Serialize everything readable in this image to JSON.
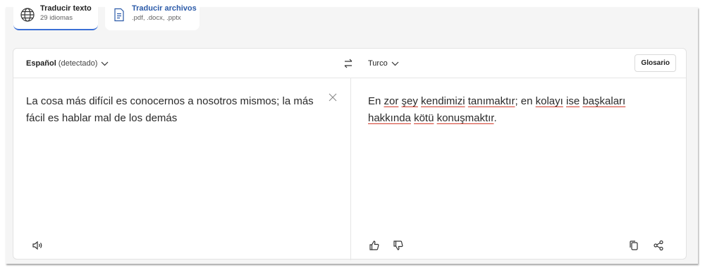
{
  "tabs": [
    {
      "title": "Traducir texto",
      "subtitle": "29 idiomas",
      "icon": "globe-icon",
      "active": true
    },
    {
      "title": "Traducir archivos",
      "subtitle": ".pdf, .docx, .pptx",
      "icon": "document-icon",
      "active": false
    }
  ],
  "source": {
    "language": "Español",
    "detected": "(detectado)",
    "text": "La cosa más difícil es conocernos a nosotros mismos; la más fácil es hablar mal de los demás"
  },
  "target": {
    "language": "Turco",
    "segments": [
      {
        "text": "En ",
        "flag": false
      },
      {
        "text": "zor",
        "flag": true
      },
      {
        "text": " ",
        "flag": false
      },
      {
        "text": "şey",
        "flag": true
      },
      {
        "text": " ",
        "flag": false
      },
      {
        "text": "kendimizi",
        "flag": true
      },
      {
        "text": " ",
        "flag": false
      },
      {
        "text": "tanımaktır",
        "flag": true
      },
      {
        "text": "; en ",
        "flag": false
      },
      {
        "text": "kolayı",
        "flag": true
      },
      {
        "text": " ",
        "flag": false
      },
      {
        "text": "ise",
        "flag": true
      },
      {
        "text": " ",
        "flag": false
      },
      {
        "text": "başkaları",
        "flag": true
      },
      {
        "text": " ",
        "flag": false
      },
      {
        "text": "hakkında",
        "flag": true
      },
      {
        "text": " ",
        "flag": false
      },
      {
        "text": "kötü",
        "flag": true
      },
      {
        "text": " ",
        "flag": false
      },
      {
        "text": "konuşmaktır",
        "flag": true
      },
      {
        "text": ".",
        "flag": false
      }
    ]
  },
  "toolbar": {
    "glossary_label": "Glosario"
  },
  "colors": {
    "accent": "#3b6fd6",
    "file_tab_title": "#2b5aa8",
    "spell_underline": "#d13b2b"
  }
}
